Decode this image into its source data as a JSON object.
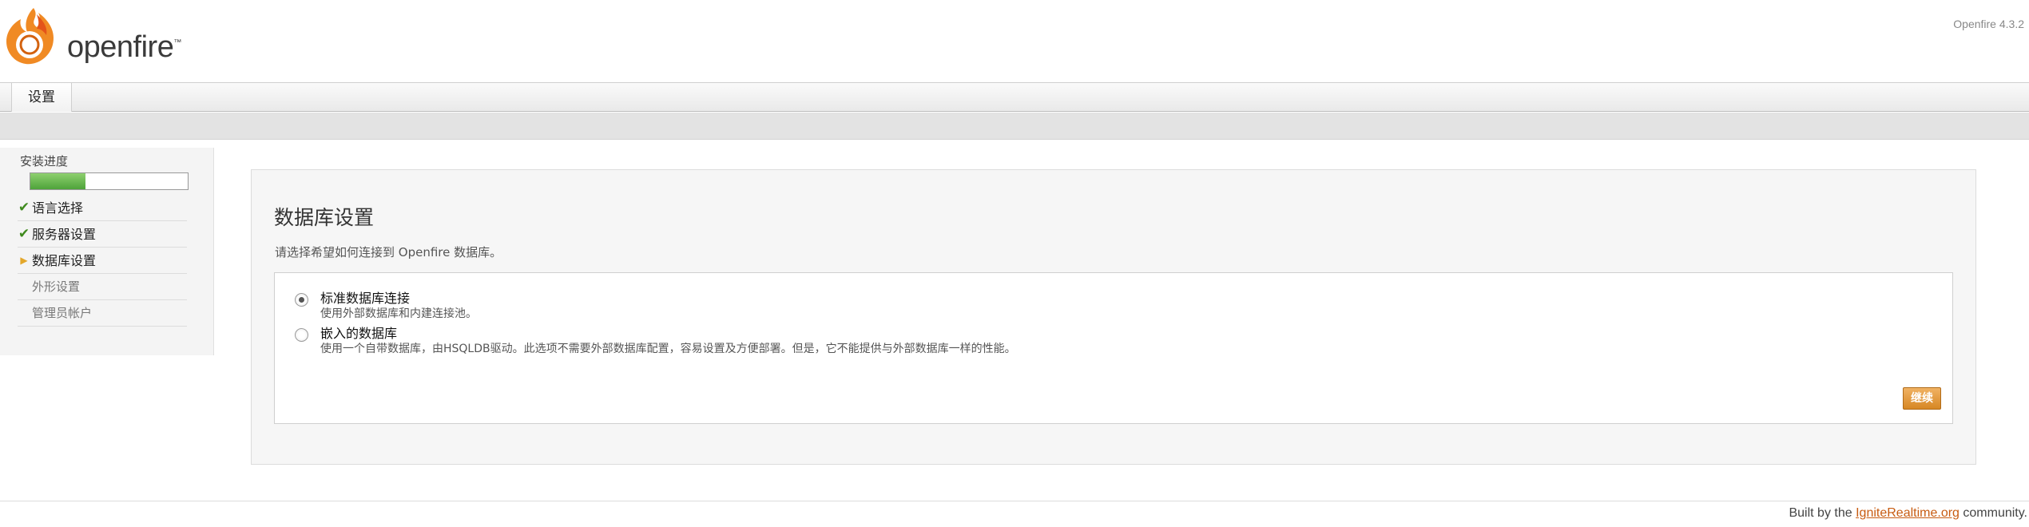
{
  "header": {
    "logo_text": "openfire",
    "logo_tm": "™",
    "version": "Openfire 4.3.2"
  },
  "tabs": [
    {
      "label": "设置"
    }
  ],
  "sidebar": {
    "progress_label": "安装进度",
    "progress_fraction": 0.35,
    "steps": [
      {
        "label": "语言选择",
        "status": "done"
      },
      {
        "label": "服务器设置",
        "status": "done"
      },
      {
        "label": "数据库设置",
        "status": "current"
      },
      {
        "label": "外形设置",
        "status": "pending"
      },
      {
        "label": "管理员帐户",
        "status": "pending"
      }
    ]
  },
  "main": {
    "title": "数据库设置",
    "description": "请选择希望如何连接到 Openfire 数据库。",
    "options": [
      {
        "title": "标准数据库连接",
        "description": "使用外部数据库和内建连接池。",
        "checked": true
      },
      {
        "title": "嵌入的数据库",
        "description": "使用一个自带数据库，由HSQLDB驱动。此选项不需要外部数据库配置，容易设置及方便部署。但是，它不能提供与外部数据库一样的性能。",
        "checked": false
      }
    ],
    "continue_label": "继续"
  },
  "footer": {
    "prefix": "Built by the ",
    "link": "IgniteRealtime.org",
    "suffix": " community."
  },
  "colors": {
    "progress": "#5fb046",
    "accent": "#d78724",
    "check": "#3f8a1e",
    "link": "#c85c12"
  }
}
